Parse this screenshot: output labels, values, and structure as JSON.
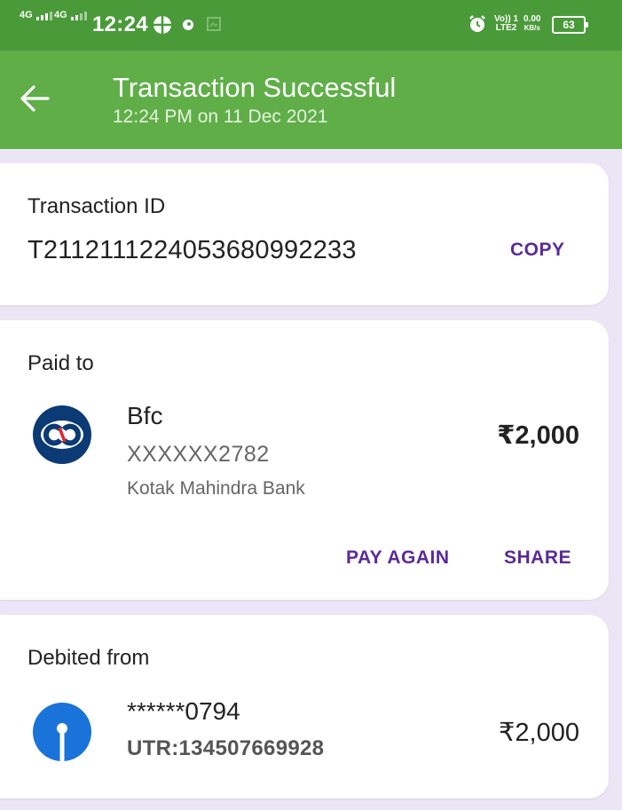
{
  "status_bar": {
    "net1": "4G",
    "net2": "4G",
    "time": "12:24",
    "volte_line1": "Vo)) 1",
    "volte_line2": "LTE2",
    "speed_value": "0.00",
    "speed_unit": "KB/s",
    "battery": "63"
  },
  "header": {
    "title": "Transaction Successful",
    "subtitle": "12:24 PM on 11 Dec 2021",
    "back_icon": "arrow-left-icon"
  },
  "transaction": {
    "label": "Transaction ID",
    "id": "T2112111224053680992233",
    "copy_label": "COPY"
  },
  "paid_to": {
    "label": "Paid to",
    "name": "Bfc",
    "account": "XXXXXX2782",
    "bank": "Kotak Mahindra Bank",
    "amount": "₹2,000",
    "pay_again_label": "PAY AGAIN",
    "share_label": "SHARE",
    "logo_icon": "kotak-bank-logo-icon"
  },
  "debited_from": {
    "label": "Debited from",
    "account": "******0794",
    "utr": "UTR:134507669928",
    "amount": "₹2,000",
    "logo_icon": "sbi-bank-logo-icon"
  },
  "colors": {
    "status_bar": "#4a9a3a",
    "header": "#5fae48",
    "accent": "#5b2a99",
    "background": "#ece5f5",
    "kotak_blue": "#0b3a74",
    "kotak_red": "#e0252b",
    "sbi_blue": "#1a73d9"
  }
}
